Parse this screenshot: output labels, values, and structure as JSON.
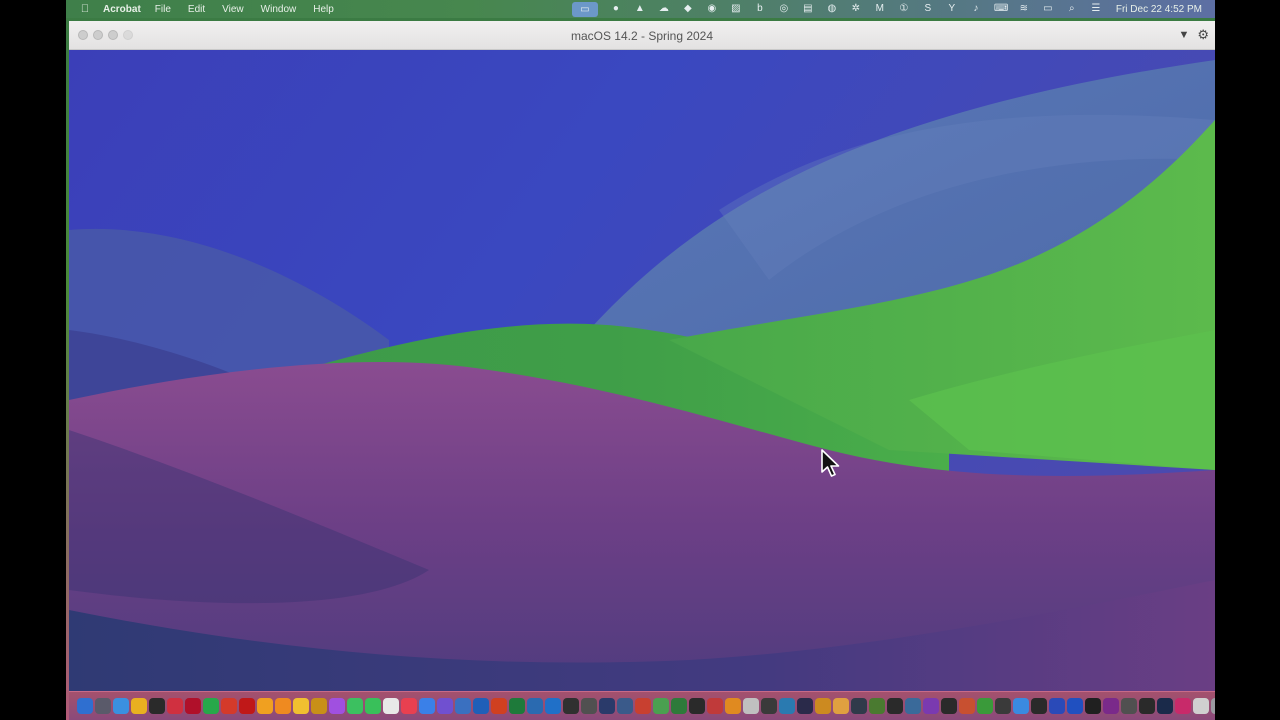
{
  "menubar": {
    "app_name": "Acrobat",
    "menus": [
      "File",
      "Edit",
      "View",
      "Window",
      "Help"
    ],
    "status_icons": [
      "screen-share-icon",
      "record-icon",
      "drive-icon",
      "cloud-sync-icon",
      "cube-icon",
      "app-icon",
      "image-icon",
      "box-icon",
      "fingerprint-icon",
      "folder-icon",
      "camera-icon",
      "settings-icon",
      "malwarebytes-icon",
      "onepassword-icon",
      "s-app-icon",
      "yt-icon",
      "volume-icon",
      "keyboard-icon",
      "wifi-icon",
      "battery-icon",
      "search-icon",
      "control-center-icon"
    ],
    "clock": "Fri Dec 22  4:52 PM"
  },
  "vm_window": {
    "title": "macOS 14.2 - Spring 2024"
  },
  "dock": {
    "colors": [
      "#2f6fd0",
      "#5a5a6a",
      "#3a90e0",
      "#e9b020",
      "#2a2a2a",
      "#d03040",
      "#b0102a",
      "#27a84a",
      "#d43a2a",
      "#c01818",
      "#f0a020",
      "#ef8a20",
      "#f0c030",
      "#c89018",
      "#a050e0",
      "#3cc060",
      "#39c05a",
      "#e8e8e8",
      "#e84050",
      "#3a80e8",
      "#7050d0",
      "#3a70c0",
      "#1f5fb8",
      "#d04020",
      "#1e7a3a",
      "#2a6ab0",
      "#2070c8",
      "#303030",
      "#505050",
      "#2a3a6a",
      "#3a5a8a",
      "#c84030",
      "#4aa050",
      "#2e7a3a",
      "#2a2a2a",
      "#c03a3a",
      "#e08a20",
      "#c0c0c0",
      "#3a3a3a",
      "#2a7ab0",
      "#2a2a4a",
      "#cc8a20",
      "#e0a040",
      "#303a4a",
      "#4a7a30",
      "#2a2a2a",
      "#3a6a9a",
      "#7a3ab0",
      "#2a2a2a",
      "#c85030",
      "#3a9a3a",
      "#3a3a3a",
      "#3a8ae0",
      "#2a2a2a",
      "#2a4ab8",
      "#2050c0",
      "#202020",
      "#7a2a8a",
      "#505050",
      "#2a2a2a",
      "#1a2a4a",
      "#c82a6a",
      "#d0d0d0",
      "#9a9aa0"
    ],
    "right_colors": [
      "#9ac0e0",
      "#4a4a50",
      "#303036",
      "#404048",
      "#cfcfcf"
    ]
  }
}
